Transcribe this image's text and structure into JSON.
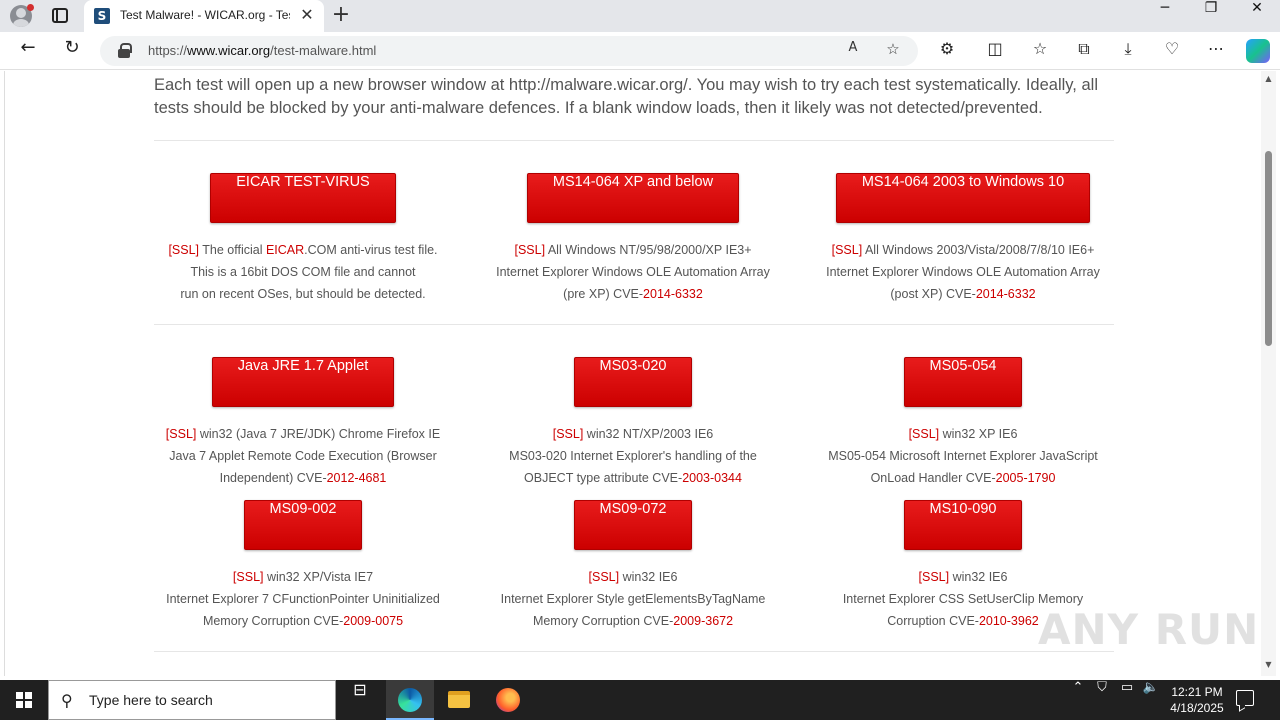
{
  "browser": {
    "tab_title": "Test Malware! - WICAR.org - Test",
    "tab_favicon_letter": "S",
    "url_prefix": "https://",
    "url_domain": "www.wicar.org",
    "url_path": "/test-malware.html"
  },
  "page": {
    "intro": "Each test will open up a new browser window at http://malware.wicar.org/. You may wish to try each test systematically. Ideally, all tests should be blocked by your anti-malware defences. If a blank window loads, then it likely was not detected/prevented.",
    "tests": [
      {
        "button": "EICAR TEST-VIRUS",
        "ssl": "[SSL]",
        "pre": " The official ",
        "red": "EICAR",
        "post": ".COM anti-virus test file.",
        "line2": "This is a 16bit DOS COM file and cannot",
        "line3": "run on recent OSes, but should be detected."
      },
      {
        "button": "MS14-064 XP and below",
        "ssl": "[SSL]",
        "line1": " All Windows NT/95/98/2000/XP IE3+",
        "line2": "Internet Explorer Windows OLE Automation Array",
        "line3_pre": "(pre  XP) CVE-",
        "cve": "2014-6332"
      },
      {
        "button": "MS14-064 2003 to Windows 10",
        "ssl": "[SSL]",
        "line1": " All Windows 2003/Vista/2008/7/8/10 IE6+",
        "line2": "Internet Explorer Windows OLE Automation Array",
        "line3_pre": "(post XP) CVE-",
        "cve": "2014-6332"
      },
      {
        "button": "Java JRE 1.7 Applet",
        "ssl": "[SSL]",
        "line1": " win32 (Java 7 JRE/JDK) Chrome Firefox IE",
        "line2": "Java 7 Applet Remote Code Execution (Browser",
        "line3_pre": "Independent) CVE-",
        "cve": "2012-4681"
      },
      {
        "button": "MS03-020",
        "ssl": "[SSL]",
        "line1": " win32 NT/XP/2003 IE6",
        "line2": "MS03-020 Internet Explorer's handling of the",
        "line3_pre": "OBJECT type attribute CVE-",
        "cve": "2003-0344"
      },
      {
        "button": "MS05-054",
        "ssl": "[SSL]",
        "line1": " win32 XP IE6",
        "line2": "MS05-054 Microsoft Internet Explorer JavaScript",
        "line3_pre": "OnLoad Handler CVE-",
        "cve": "2005-1790"
      },
      {
        "button": "MS09-002",
        "ssl": "[SSL]",
        "line1": " win32 XP/Vista IE7",
        "line2": "Internet Explorer 7 CFunctionPointer Uninitialized",
        "line3_pre": "Memory Corruption CVE-",
        "cve": "2009-0075"
      },
      {
        "button": "MS09-072",
        "ssl": "[SSL]",
        "line1": " win32 IE6",
        "line2": "Internet Explorer Style getElementsByTagName",
        "line3_pre": "Memory Corruption CVE-",
        "cve": "2009-3672"
      },
      {
        "button": "MS10-090",
        "ssl": "[SSL]",
        "line1": " win32 IE6",
        "line2": "Internet Explorer CSS SetUserClip Memory",
        "line3_pre": "Corruption CVE-",
        "cve": "2010-3962"
      }
    ]
  },
  "taskbar": {
    "search_placeholder": "Type here to search",
    "time": "12:21 PM",
    "date": "4/18/2025"
  },
  "watermark": "ANY RUN",
  "colors": {
    "accent_red": "#cc0000",
    "button_red": "#e81c1c"
  }
}
